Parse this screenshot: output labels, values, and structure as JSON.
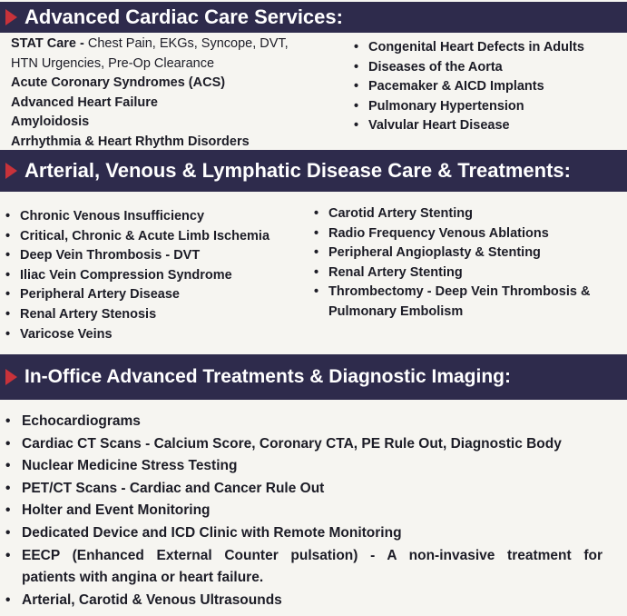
{
  "sections": [
    {
      "title": "Advanced Cardiac Care Services:",
      "left": {
        "stat_label": "STAT Care -",
        "stat_text": "Chest Pain, EKGs, Syncope, DVT,",
        "stat_text2": "HTN Urgencies, Pre-Op Clearance",
        "items": [
          "Acute Coronary Syndromes (ACS)",
          "Advanced Heart Failure",
          "Amyloidosis",
          "Arrhythmia & Heart Rhythm Disorders"
        ]
      },
      "right": [
        "Congenital Heart Defects in Adults",
        "Diseases of the Aorta",
        "Pacemaker & AICD Implants",
        "Pulmonary Hypertension",
        "Valvular Heart Disease"
      ]
    },
    {
      "title": "Arterial, Venous & Lymphatic Disease Care & Treatments:",
      "left": [
        "Chronic Venous Insufficiency",
        "Critical, Chronic & Acute Limb Ischemia",
        "Deep Vein Thrombosis - DVT",
        "Iliac Vein Compression Syndrome",
        "Peripheral Artery Disease",
        "Renal Artery Stenosis",
        "Varicose Veins"
      ],
      "right": [
        "Carotid Artery Stenting",
        "Radio Frequency Venous Ablations",
        "Peripheral Angioplasty & Stenting",
        "Renal Artery Stenting",
        "Thrombectomy - Deep Vein Thrombosis &",
        "Pulmonary Embolism"
      ]
    },
    {
      "title": "In-Office Advanced Treatments & Diagnostic Imaging:",
      "items": [
        "Echocardiograms",
        "Cardiac CT Scans - Calcium Score, Coronary CTA, PE Rule Out, Diagnostic Body",
        "Nuclear Medicine Stress Testing",
        "PET/CT Scans - Cardiac and Cancer Rule Out",
        "Holter and Event Monitoring",
        "Dedicated Device and ICD Clinic with Remote Monitoring",
        "EECP (Enhanced External Counter pulsation) - A non-invasive treatment for",
        "patients with angina or heart failure.",
        "Arterial, Carotid & Venous Ultrasounds"
      ]
    }
  ],
  "colors": {
    "banner": "#2e2b4c",
    "arrow": "#c8323a",
    "text": "#1c1c26",
    "background": "#f6f5f1"
  }
}
